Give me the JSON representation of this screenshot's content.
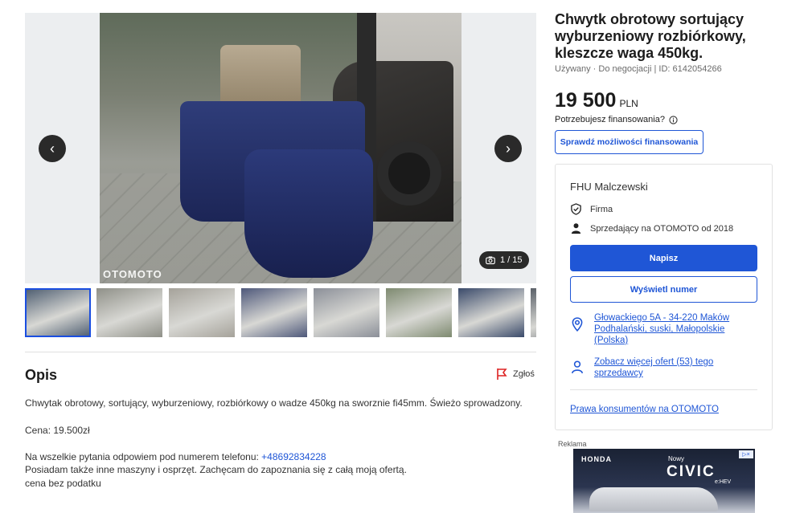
{
  "gallery": {
    "watermark": "OTOMOTO",
    "counter": "1 / 15",
    "thumb_colors": [
      "#4a5a6e",
      "#8f9088",
      "#a5a29a",
      "#4e587a",
      "#8b8f98",
      "#7e8a70",
      "#3a4a6a",
      "#5a6068"
    ]
  },
  "listing": {
    "title": "Chwytk obrotowy sortujący wyburzeniowy rozbiórkowy, kleszcze waga 450kg.",
    "meta": "Używany · Do negocjacji | ID: 6142054266",
    "price": "19 500",
    "currency": "PLN",
    "finance_question": "Potrzebujesz finansowania?",
    "finance_button": "Sprawdź możliwości finansowania"
  },
  "seller": {
    "name": "FHU Malczewski",
    "type": "Firma",
    "since": "Sprzedający na OTOMOTO od 2018",
    "write_button": "Napisz",
    "show_number_button": "Wyświetl numer",
    "address": "Głowackiego 5A - 34-220 Maków Podhalański, suski, Małopolskie (Polska)",
    "more_offers": "Zobacz więcej ofert (53) tego sprzedawcy",
    "consumer_rights": "Prawa konsumentów na OTOMOTO"
  },
  "description": {
    "heading": "Opis",
    "report": "Zgłoś",
    "line1": "Chwytak obrotowy, sortujący, wyburzeniowy, rozbiórkowy o wadze 450kg na sworznie fi45mm. Świeżo sprowadzony.",
    "line2": "Cena: 19.500zł",
    "line3_prefix": "Na wszelkie pytania odpowiem pod numerem telefonu:",
    "phone": "+48692834228",
    "line4": "Posiadam także inne maszyny i osprzęt. Zachęcam do zapoznania się z całą moją ofertą.",
    "line5": "cena bez podatku"
  },
  "ad": {
    "label": "Reklama",
    "brand": "HONDA",
    "nowy": "Nowy",
    "model": "CIVIC",
    "variant": "e:HEV"
  }
}
